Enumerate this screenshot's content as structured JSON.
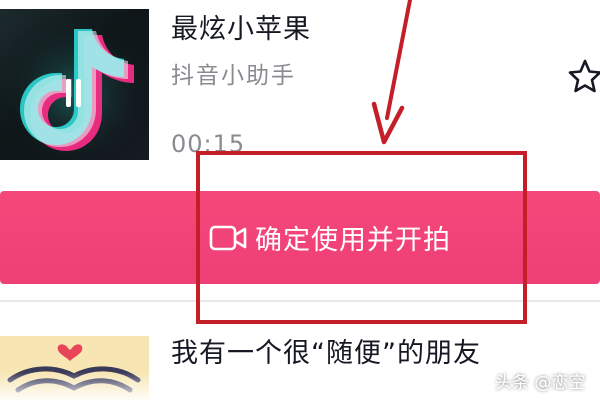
{
  "song_list": {
    "items": [
      {
        "title": "最炫小苹果",
        "artist": "抖音小助手",
        "duration": "00:15",
        "favorite_icon": "star-outline-icon",
        "cover_icon": "tiktok-logo-icon"
      },
      {
        "title": "我有一个很“随便”的朋友",
        "cover_icon": "heart-book-icon"
      }
    ]
  },
  "confirm_button": {
    "label": "确定使用并开拍",
    "icon": "video-camera-icon",
    "color": "#f0447a"
  },
  "annotation": {
    "color": "#c41e28"
  },
  "watermark": {
    "text": "头条 @恋空"
  }
}
